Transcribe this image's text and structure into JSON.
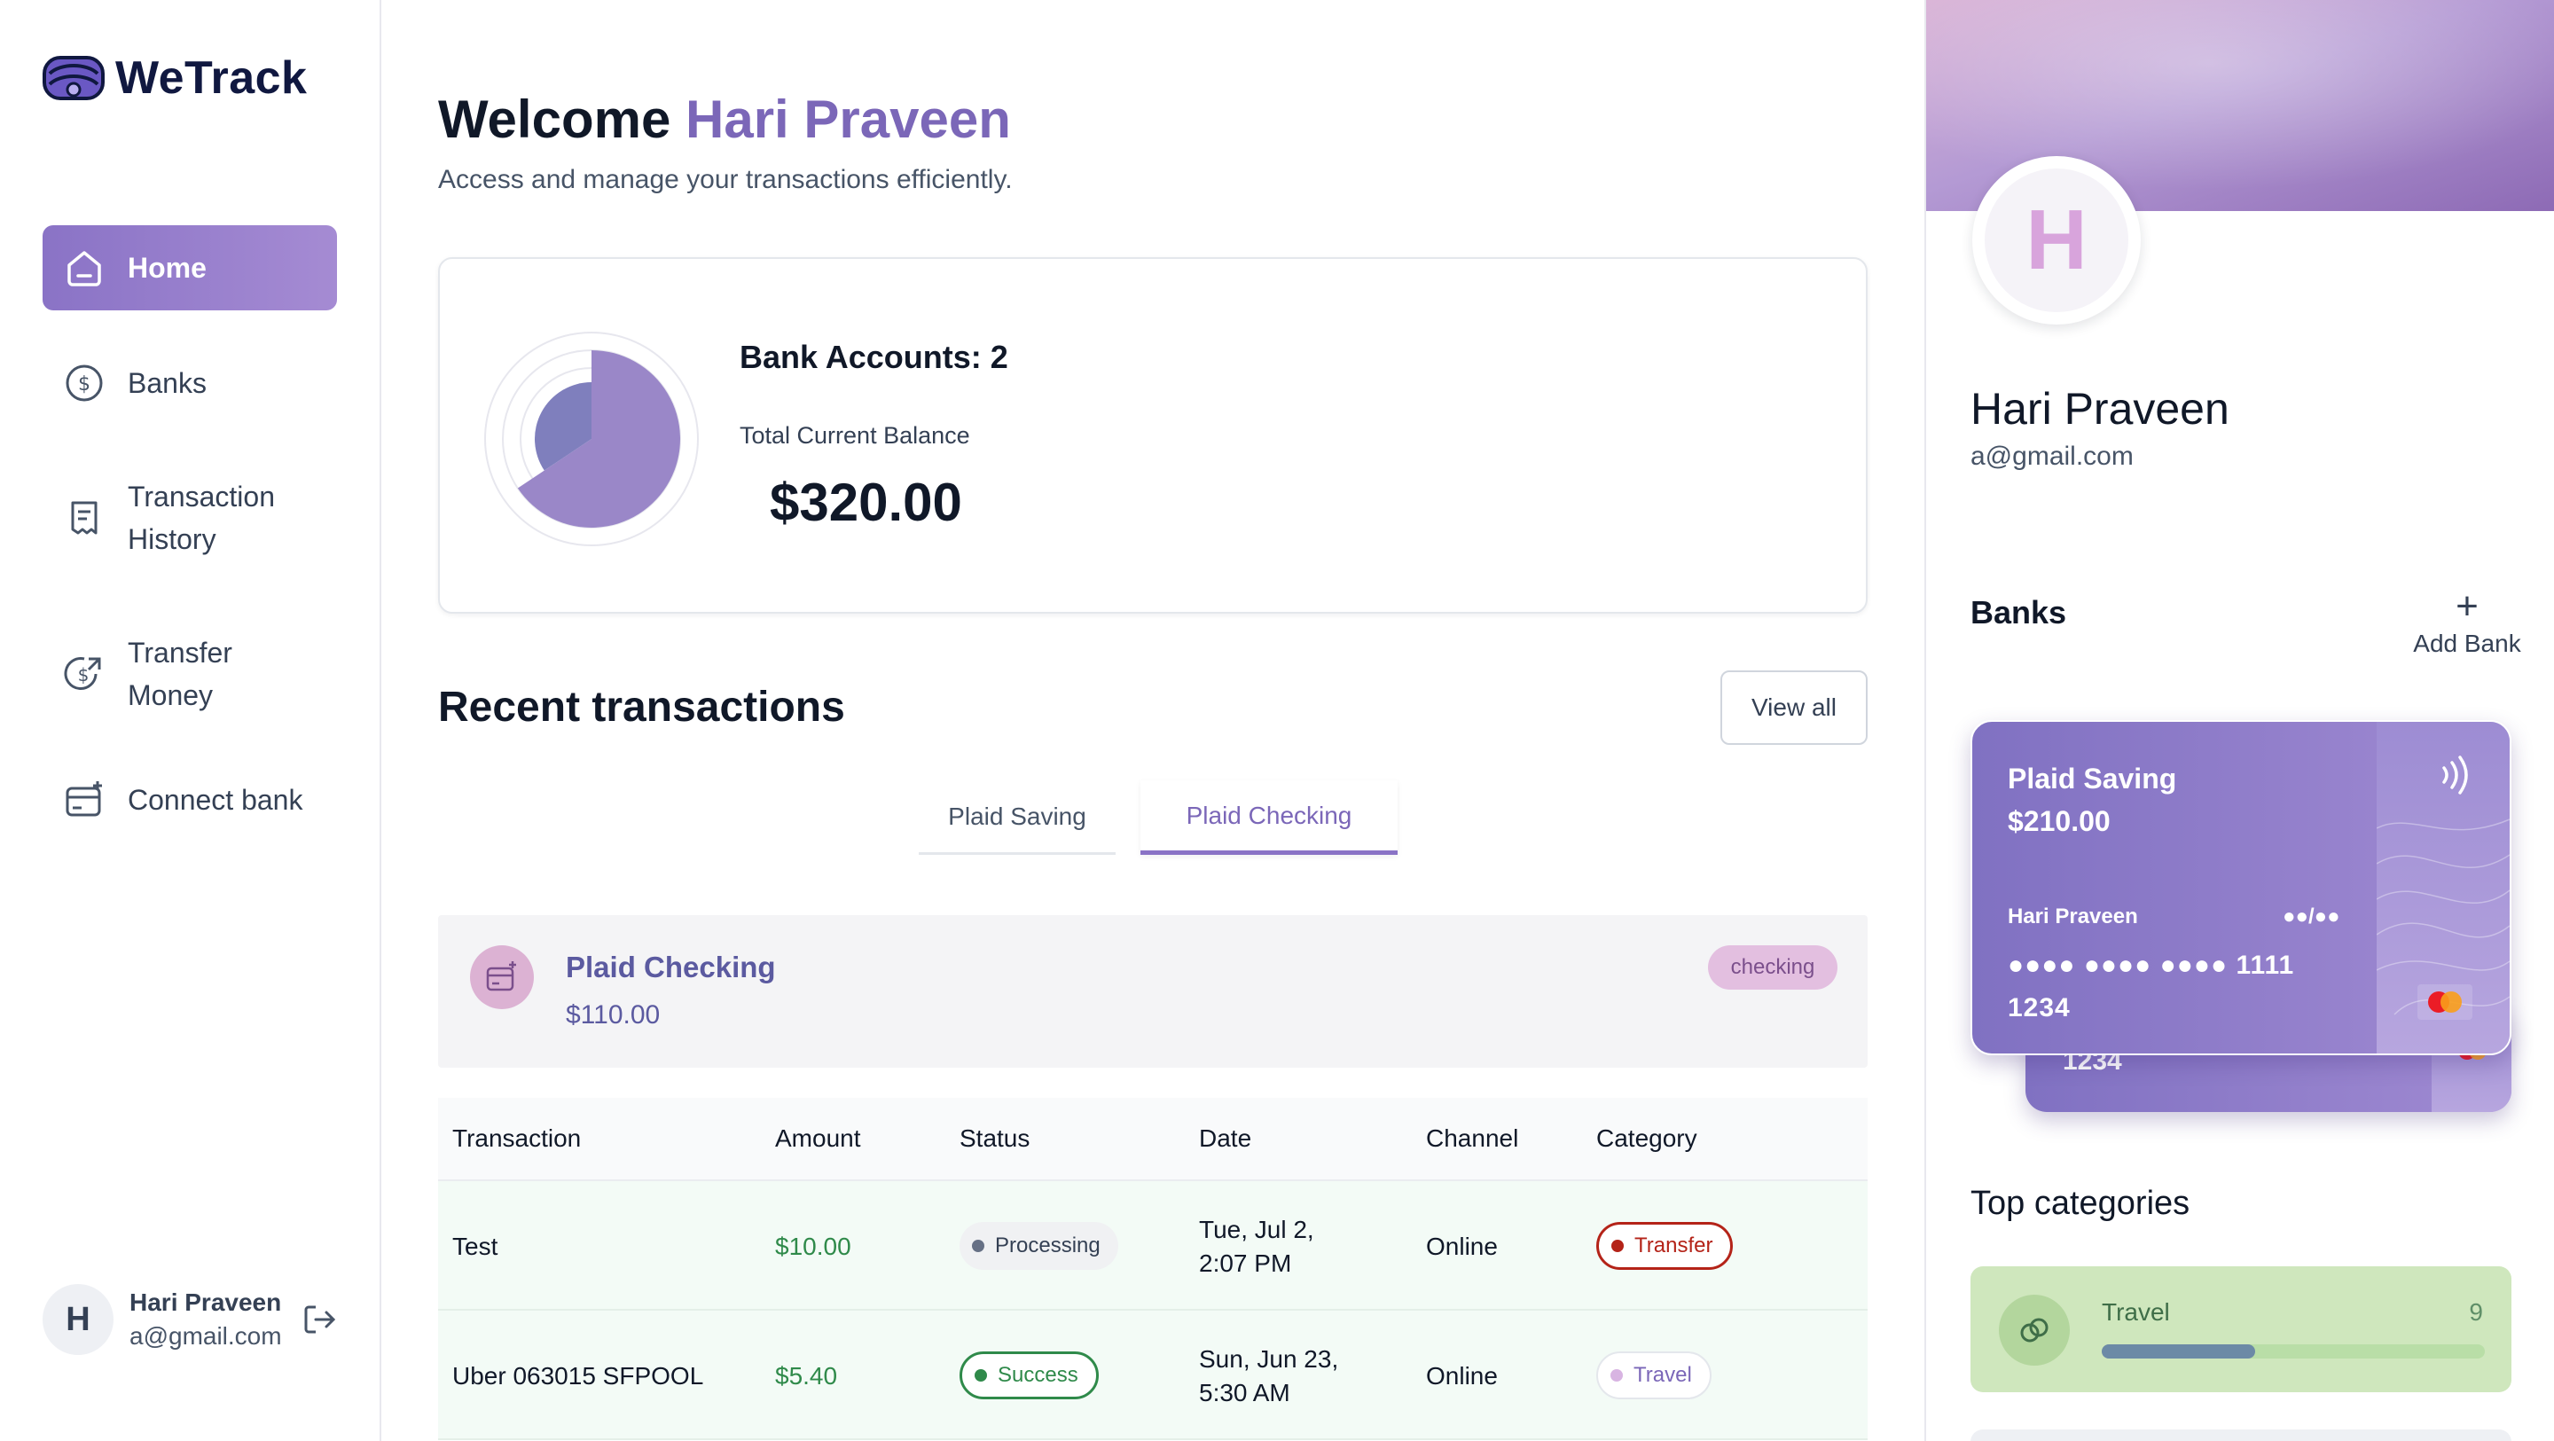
{
  "app": {
    "name": "WeTrack",
    "brand_color": "#8a73c6"
  },
  "sidebar": {
    "items": [
      {
        "label": "Home",
        "icon": "home-icon",
        "active": true
      },
      {
        "label": "Banks",
        "icon": "dollar-circle-icon",
        "active": false
      },
      {
        "label": "Transaction History",
        "icon": "receipt-icon",
        "active": false
      },
      {
        "label": "Transfer Money",
        "icon": "money-send-icon",
        "active": false
      },
      {
        "label": "Connect bank",
        "icon": "connect-bank-icon",
        "active": false
      }
    ],
    "footer": {
      "initial": "H",
      "name": "Hari Praveen",
      "email": "a@gmail.com"
    }
  },
  "header": {
    "welcome_prefix": "Welcome",
    "user_name": "Hari Praveen",
    "subtitle": "Access and manage your transactions efficiently."
  },
  "balance": {
    "accounts_label": "Bank Accounts: 2",
    "total_label": "Total Current Balance",
    "total_amount": "$320.00",
    "donut": {
      "values": [
        210,
        110
      ],
      "colors": [
        "#9a87c8",
        "#7f7fbd"
      ]
    }
  },
  "recent": {
    "title": "Recent transactions",
    "view_all": "View all",
    "tabs": [
      "Plaid Saving",
      "Plaid Checking"
    ],
    "active_tab": 1,
    "account": {
      "name": "Plaid Checking",
      "balance": "$110.00",
      "type": "checking"
    },
    "columns": [
      "Transaction",
      "Amount",
      "Status",
      "Date",
      "Channel",
      "Category"
    ],
    "rows": [
      {
        "name": "Test",
        "amount": "$10.00",
        "status": "Processing",
        "date_line1": "Tue, Jul 2,",
        "date_line2": "2:07 PM",
        "channel": "Online",
        "category": "Transfer"
      },
      {
        "name": "Uber 063015 SFPOOL",
        "amount": "$5.40",
        "status": "Success",
        "date_line1": "Sun, Jun 23,",
        "date_line2": "5:30 AM",
        "channel": "Online",
        "category": "Travel"
      }
    ]
  },
  "profile": {
    "initial": "H",
    "name": "Hari Praveen",
    "email": "a@gmail.com",
    "banks_title": "Banks",
    "add_bank": "Add Bank",
    "card": {
      "name": "Plaid Saving",
      "balance": "$210.00",
      "holder": "Hari Praveen",
      "expiry": "●●/●●",
      "number": "●●●● ●●●● ●●●● 1111",
      "number_line2": "1234",
      "back_number": "1234"
    },
    "top_categories_title": "Top categories",
    "categories": [
      {
        "name": "Travel",
        "count": "9",
        "progress": 0.4
      }
    ]
  }
}
